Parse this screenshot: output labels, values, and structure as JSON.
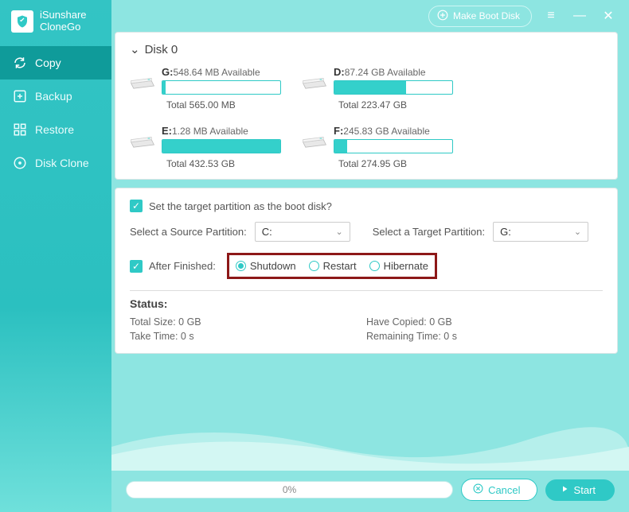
{
  "app": {
    "title_line1": "iSunshare",
    "title_line2": "CloneGo"
  },
  "header": {
    "make_boot_disk": "Make Boot Disk"
  },
  "nav": {
    "copy": "Copy",
    "backup": "Backup",
    "restore": "Restore",
    "disk_clone": "Disk Clone"
  },
  "disk": {
    "header": "Disk 0",
    "partitions": [
      {
        "letter": "G:",
        "available": "548.64 MB Available",
        "total": "Total 565.00 MB",
        "fill_pct": 3
      },
      {
        "letter": "D:",
        "available": "87.24 GB Available",
        "total": "Total 223.47 GB",
        "fill_pct": 61
      },
      {
        "letter": "E:",
        "available": "1.28 MB Available",
        "total": "Total 432.53 GB",
        "fill_pct": 100
      },
      {
        "letter": "F:",
        "available": "245.83 GB Available",
        "total": "Total 274.95 GB",
        "fill_pct": 11
      }
    ]
  },
  "settings": {
    "set_boot_label": "Set the target partition as the boot disk?",
    "source_label": "Select a Source Partition:",
    "source_value": "C:",
    "target_label": "Select a Target Partition:",
    "target_value": "G:",
    "after_label": "After Finished:",
    "after_options": {
      "shutdown": "Shutdown",
      "restart": "Restart",
      "hibernate": "Hibernate"
    },
    "after_selected": "shutdown"
  },
  "status": {
    "heading": "Status:",
    "total_size_label": "Total Size:",
    "total_size_value": "0 GB",
    "have_copied_label": "Have Copied:",
    "have_copied_value": "0 GB",
    "take_time_label": "Take Time:",
    "take_time_value": "0 s",
    "remaining_label": "Remaining Time:",
    "remaining_value": "0 s"
  },
  "footer": {
    "progress": "0%",
    "cancel": "Cancel",
    "start": "Start"
  }
}
